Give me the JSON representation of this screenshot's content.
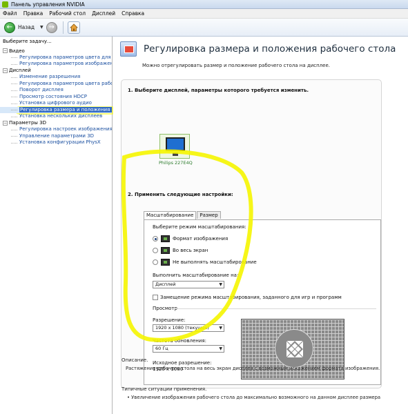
{
  "window": {
    "title": "Панель управления NVIDIA"
  },
  "menu": [
    "Файл",
    "Правка",
    "Рабочий стол",
    "Дисплей",
    "Справка"
  ],
  "toolbar": {
    "back_label": "Назад"
  },
  "sidebar": {
    "heading": "Выберите задачу...",
    "categories": [
      {
        "label": "Видео",
        "items": [
          "Регулировка параметров цвета для вид",
          "Регулировка параметров изображения д"
        ]
      },
      {
        "label": "Дисплей",
        "items": [
          "Изменение разрешения",
          "Регулировка параметров цвета рабочег",
          "Поворот дисплея",
          "Просмотр состояния HDCP",
          "Установка цифрового аудио",
          "Регулировка размера и положения рабо",
          "Установка нескольких дисплеев"
        ]
      },
      {
        "label": "Параметры 3D",
        "items": [
          "Регулировка настроек изображения с пр",
          "Управление параметрами 3D",
          "Установка конфигурации PhysX"
        ]
      }
    ]
  },
  "main": {
    "title": "Регулировка размера и положения рабочего стола",
    "subtitle": "Можно отрегулировать размер и положение рабочего стола на дисплее.",
    "step1": "1. Выберите дисплей, параметры которого требуется изменить.",
    "display_name": "Philips 227E4Q",
    "step2": "2. Применить следующие настройки:",
    "tabs": [
      "Масштабирование",
      "Размер"
    ],
    "scaling_mode_label": "Выберите режим масштабирования:",
    "modes": [
      "Формат изображения",
      "Во весь экран",
      "Не выполнять масштабирование"
    ],
    "perform_on_label": "Выполнить масштабирование на:",
    "perform_on_value": "Дисплей",
    "override_checkbox": "Замещение режима масштабирования, заданного для игр и программ",
    "preview_label": "Просмотр",
    "resolution_label": "Разрешение:",
    "resolution_value": "1920 x 1080 (текущее)",
    "refresh_label": "Частота обновления:",
    "refresh_value": "60 Гц",
    "source_res_label": "Исходное разрешение:",
    "source_res_value": "1920 x 1080",
    "description_head": "Описание.",
    "description_text": "Растяжение рабочего стола на весь экран дисплея с возможным искажением формата изображения.",
    "typical_head": "Типичные ситуации применения.",
    "typical_text": "• Увеличение изображения рабочего стола до максимально возможного на данном дисплее размера"
  },
  "colors": {
    "highlight": "#faff00",
    "link": "#1a4fa0",
    "nvidia_green": "#76b900"
  }
}
